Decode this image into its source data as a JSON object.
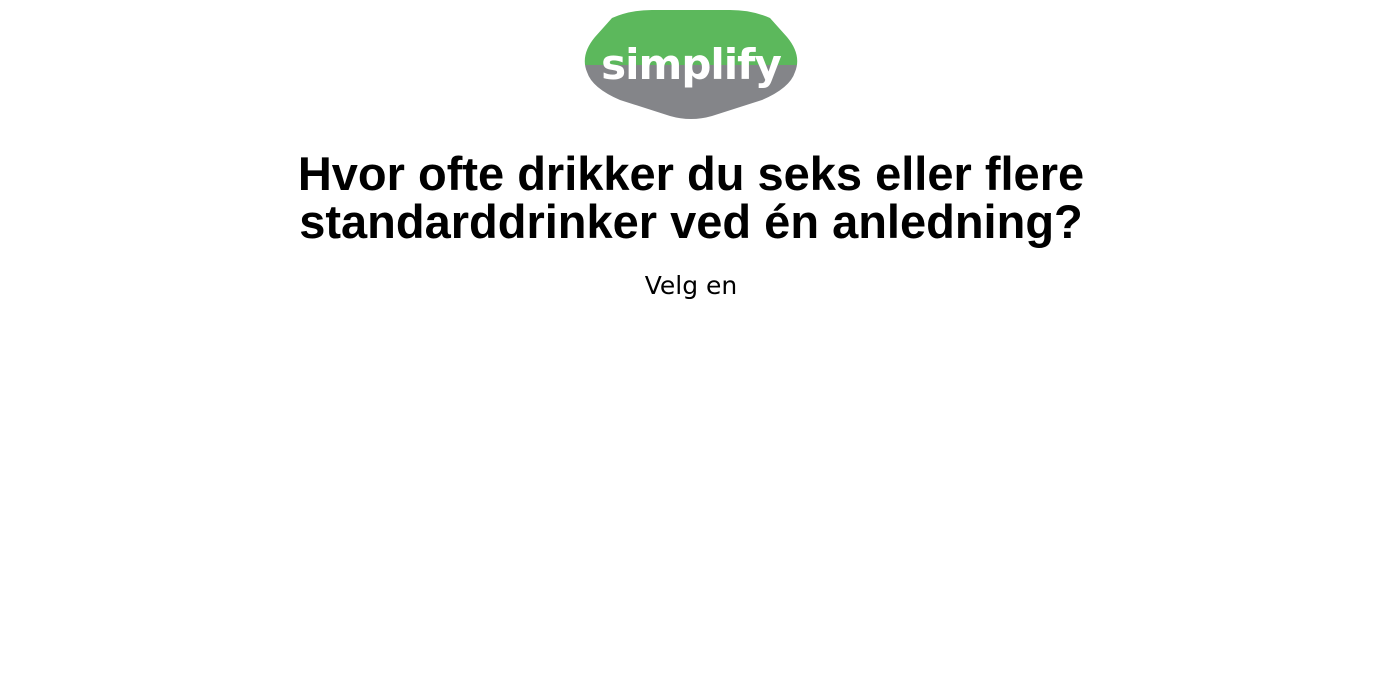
{
  "logo": {
    "text": "simplify",
    "colors": {
      "top": "#5cb85c",
      "bottom": "#848589",
      "text": "#ffffff"
    }
  },
  "question": {
    "line1": "Hvor ofte drikker du seks eller flere",
    "line2": "standarddrinker ved én anledning?"
  },
  "instruction": "Velg en"
}
